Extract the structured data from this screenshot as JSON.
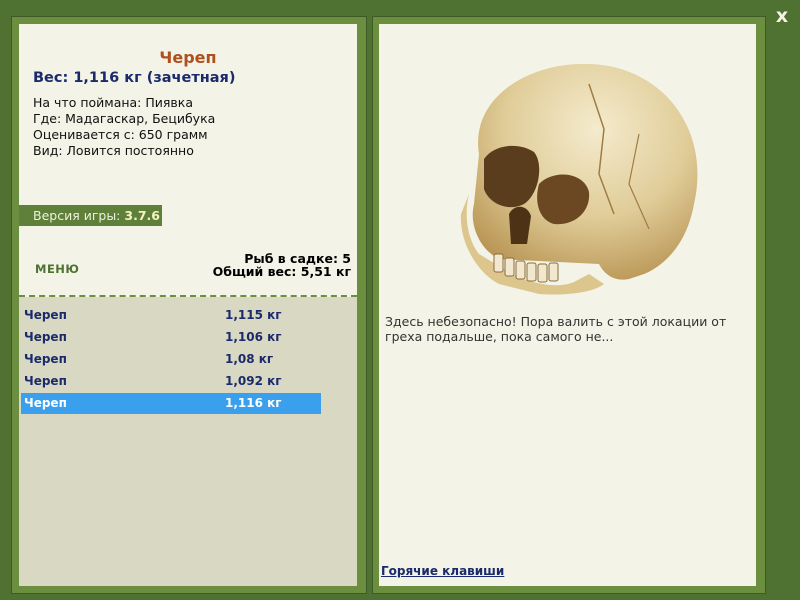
{
  "close_label": "x",
  "fish": {
    "title": "Череп",
    "weight_line": "Вес: 1,116 кг (зачетная)",
    "caught_on": "На что поймана: Пиявка",
    "where": "Где: Мадагаскар, Бецибука",
    "value": "Оценивается с: 650 грамм",
    "kind": "Вид: Ловится постоянно"
  },
  "version": {
    "label": "Версия игры:",
    "number": "3.7.6"
  },
  "menu_label": "МЕНЮ",
  "stats": {
    "count": "Рыб в садке: 5",
    "total": "Общий вес: 5,51 кг"
  },
  "catch_list": [
    {
      "name": "Череп",
      "weight": "1,115 кг",
      "selected": false
    },
    {
      "name": "Череп",
      "weight": "1,106 кг",
      "selected": false
    },
    {
      "name": "Череп",
      "weight": "1,08 кг",
      "selected": false
    },
    {
      "name": "Череп",
      "weight": "1,092 кг",
      "selected": false
    },
    {
      "name": "Череп",
      "weight": "1,116 кг",
      "selected": true
    }
  ],
  "description": "Здесь небезопасно! Пора валить с этой локации от греха подальше, пока самого не...",
  "hotkeys_label": "Горячие клавиши",
  "colors": {
    "background": "#4f7131",
    "panel": "#f3f3e7",
    "list": "#d9d9c3",
    "selected": "#3aa0ee",
    "title": "#b0501c",
    "text_blue": "#1a2a6b"
  }
}
